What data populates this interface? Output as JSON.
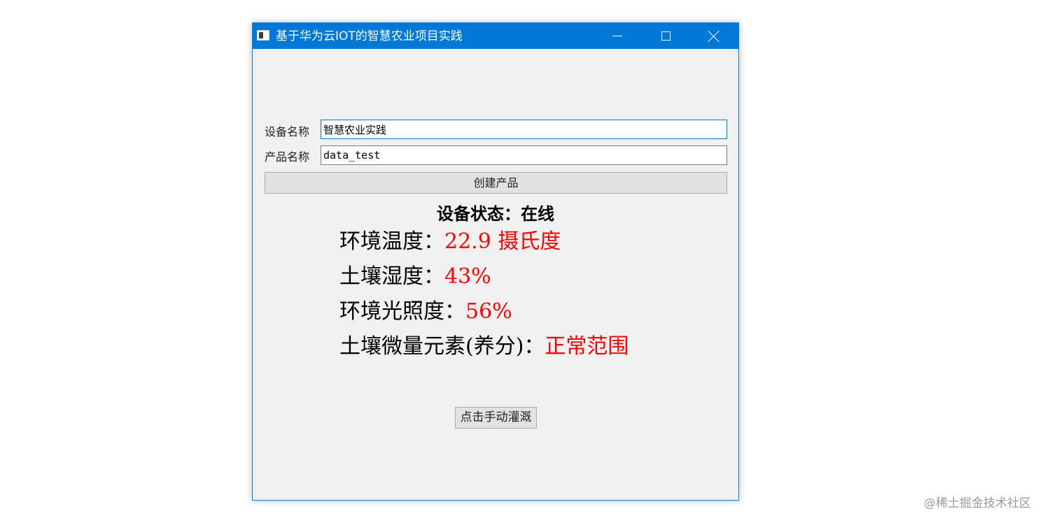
{
  "window": {
    "title": "基于华为云IOT的智慧农业项目实践",
    "icon": "app-window-icon",
    "controls": {
      "minimize_icon": "minimize-icon",
      "maximize_icon": "maximize-icon",
      "close_icon": "close-icon"
    }
  },
  "form": {
    "device_label": "设备名称",
    "device_value": "智慧农业实践",
    "product_label": "产品名称",
    "product_value": "data_test",
    "create_button": "创建产品"
  },
  "status": {
    "text": "设备状态：在线"
  },
  "readings": [
    {
      "label": "环境温度：",
      "value": "22.9 摄氏度"
    },
    {
      "label": "土壤湿度：",
      "value": "43%"
    },
    {
      "label": "环境光照度：",
      "value": "56%"
    },
    {
      "label": "土壤微量元素(养分)：",
      "value": "正常范围"
    }
  ],
  "actions": {
    "irrigate_button": "点击手动灌溉"
  },
  "watermark": "@稀土掘金技术社区",
  "colors": {
    "titlebar": "#0078d7",
    "value_red": "#ff0000",
    "window_bg": "#f0f0f0"
  }
}
